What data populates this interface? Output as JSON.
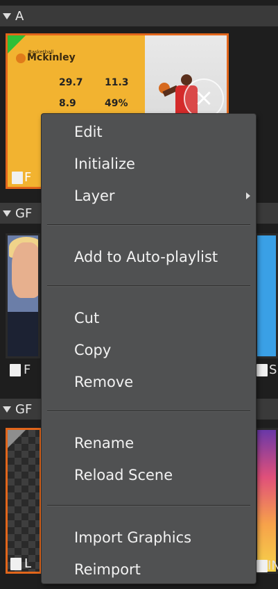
{
  "sections": [
    {
      "label": "A"
    },
    {
      "label": "GF"
    },
    {
      "label": "GF"
    }
  ],
  "thumb_a": {
    "brand_small": "Basketball",
    "brand_name": "Mckinley",
    "stat1": "29.7",
    "stat2": "11.3",
    "stat3": "8.9",
    "stat4": "49%",
    "close_glyph": "×",
    "footer_label": "F"
  },
  "thumb_b": {
    "footer_label": "F"
  },
  "thumb_c": {
    "footer_label": "S"
  },
  "thumb_d": {
    "footer_label": "L"
  },
  "thumb_e": {
    "footer_label": "IN"
  },
  "context_menu": {
    "items": [
      {
        "label": "Edit"
      },
      {
        "label": "Initialize"
      },
      {
        "label": "Layer"
      },
      {
        "label": "Add to Auto-playlist"
      },
      {
        "label": "Cut"
      },
      {
        "label": "Copy"
      },
      {
        "label": "Remove"
      },
      {
        "label": "Rename"
      },
      {
        "label": "Reload Scene"
      },
      {
        "label": "Import Graphics"
      },
      {
        "label": "Reimport"
      }
    ]
  },
  "colors": {
    "background": "#1e1e1e",
    "menu_bg": "#505152",
    "accent_orange": "#e2661b",
    "header_bg": "#3a3a3a"
  }
}
